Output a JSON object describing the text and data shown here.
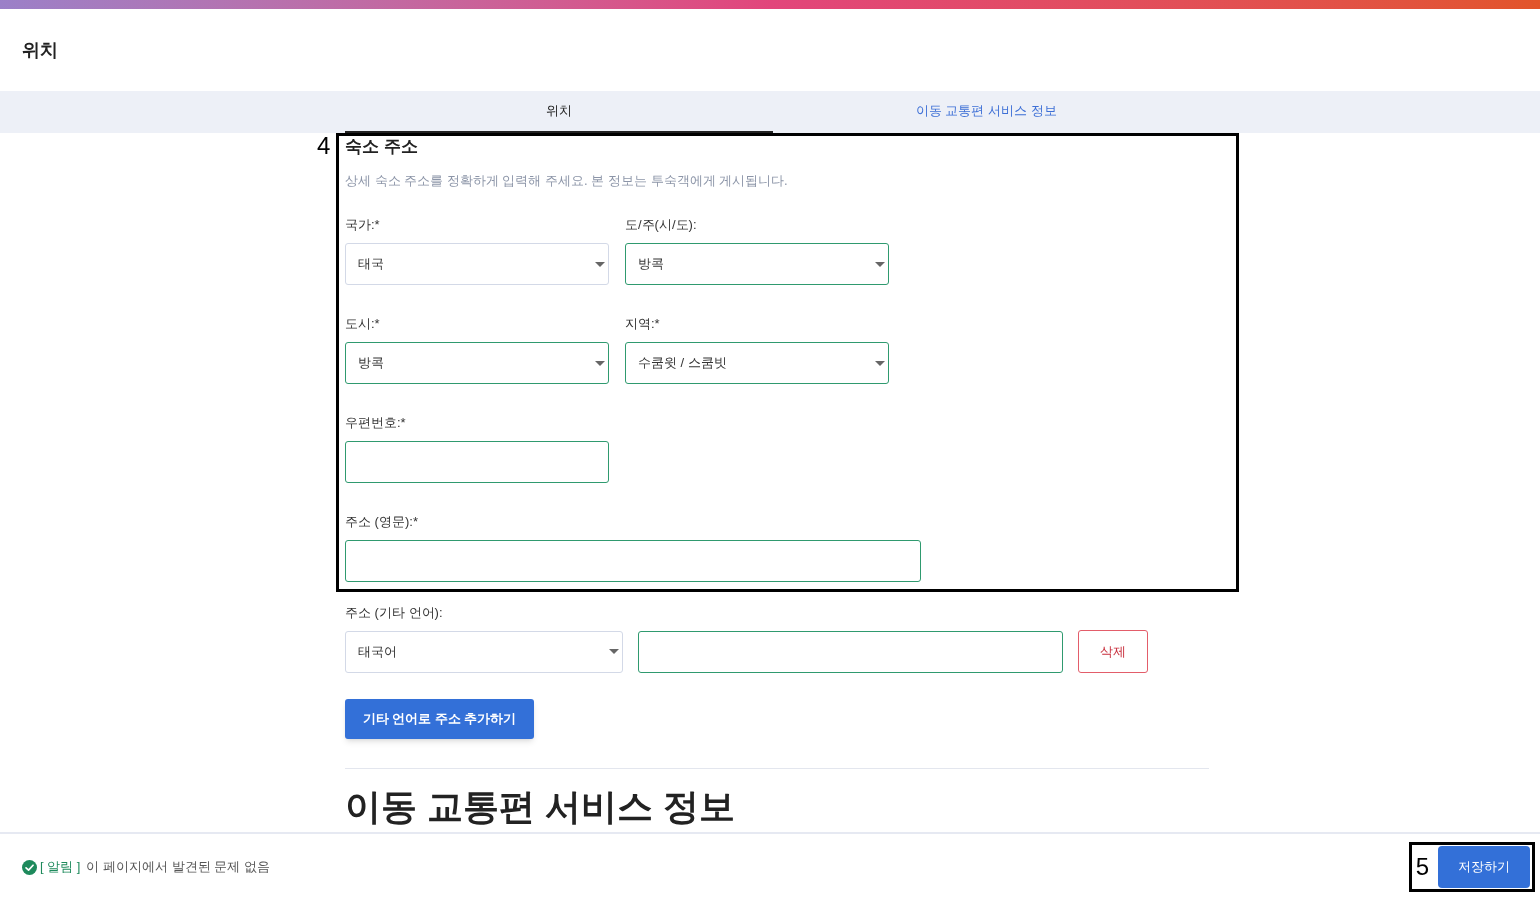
{
  "header": {
    "title": "위치"
  },
  "tabs": [
    {
      "label": "위치",
      "selected": true
    },
    {
      "label": "이동 교통편 서비스 정보",
      "selected": false
    }
  ],
  "address_section": {
    "annotation": "4",
    "title": "숙소 주소",
    "description": "상세 숙소 주소를 정확하게 입력해 주세요. 본 정보는 투숙객에게 게시됩니다.",
    "rows": [
      [
        {
          "kind": "select",
          "label": "국가:*",
          "value": "태국",
          "validated": false
        },
        {
          "kind": "select",
          "label": "도/주(시/도):",
          "value": "방콕",
          "validated": true
        }
      ],
      [
        {
          "kind": "select",
          "label": "도시:*",
          "value": "방콕",
          "validated": true
        },
        {
          "kind": "select",
          "label": "지역:*",
          "value": "수쿰윗 / 스쿰빗",
          "validated": true
        }
      ],
      [
        {
          "kind": "text",
          "label": "우편번호:*",
          "validated": true
        }
      ],
      [
        {
          "kind": "address",
          "label": "주소 (영문):*",
          "validated": true
        }
      ]
    ]
  },
  "other_language": {
    "label": "주소 (기타 언어):",
    "language": {
      "value": "태국어",
      "validated": false
    },
    "address": {
      "validated": true
    },
    "delete_button": "삭제"
  },
  "add_button": "기타 언어로 주소 추가하기",
  "transport_section": {
    "title": "이동 교통편 서비스 정보"
  },
  "footer": {
    "status": {
      "tag": "[ 알림 ]",
      "message": "이 페이지에서 발견된 문제 없음"
    },
    "save_button": {
      "label": "저장하기",
      "annotation": "5"
    }
  }
}
